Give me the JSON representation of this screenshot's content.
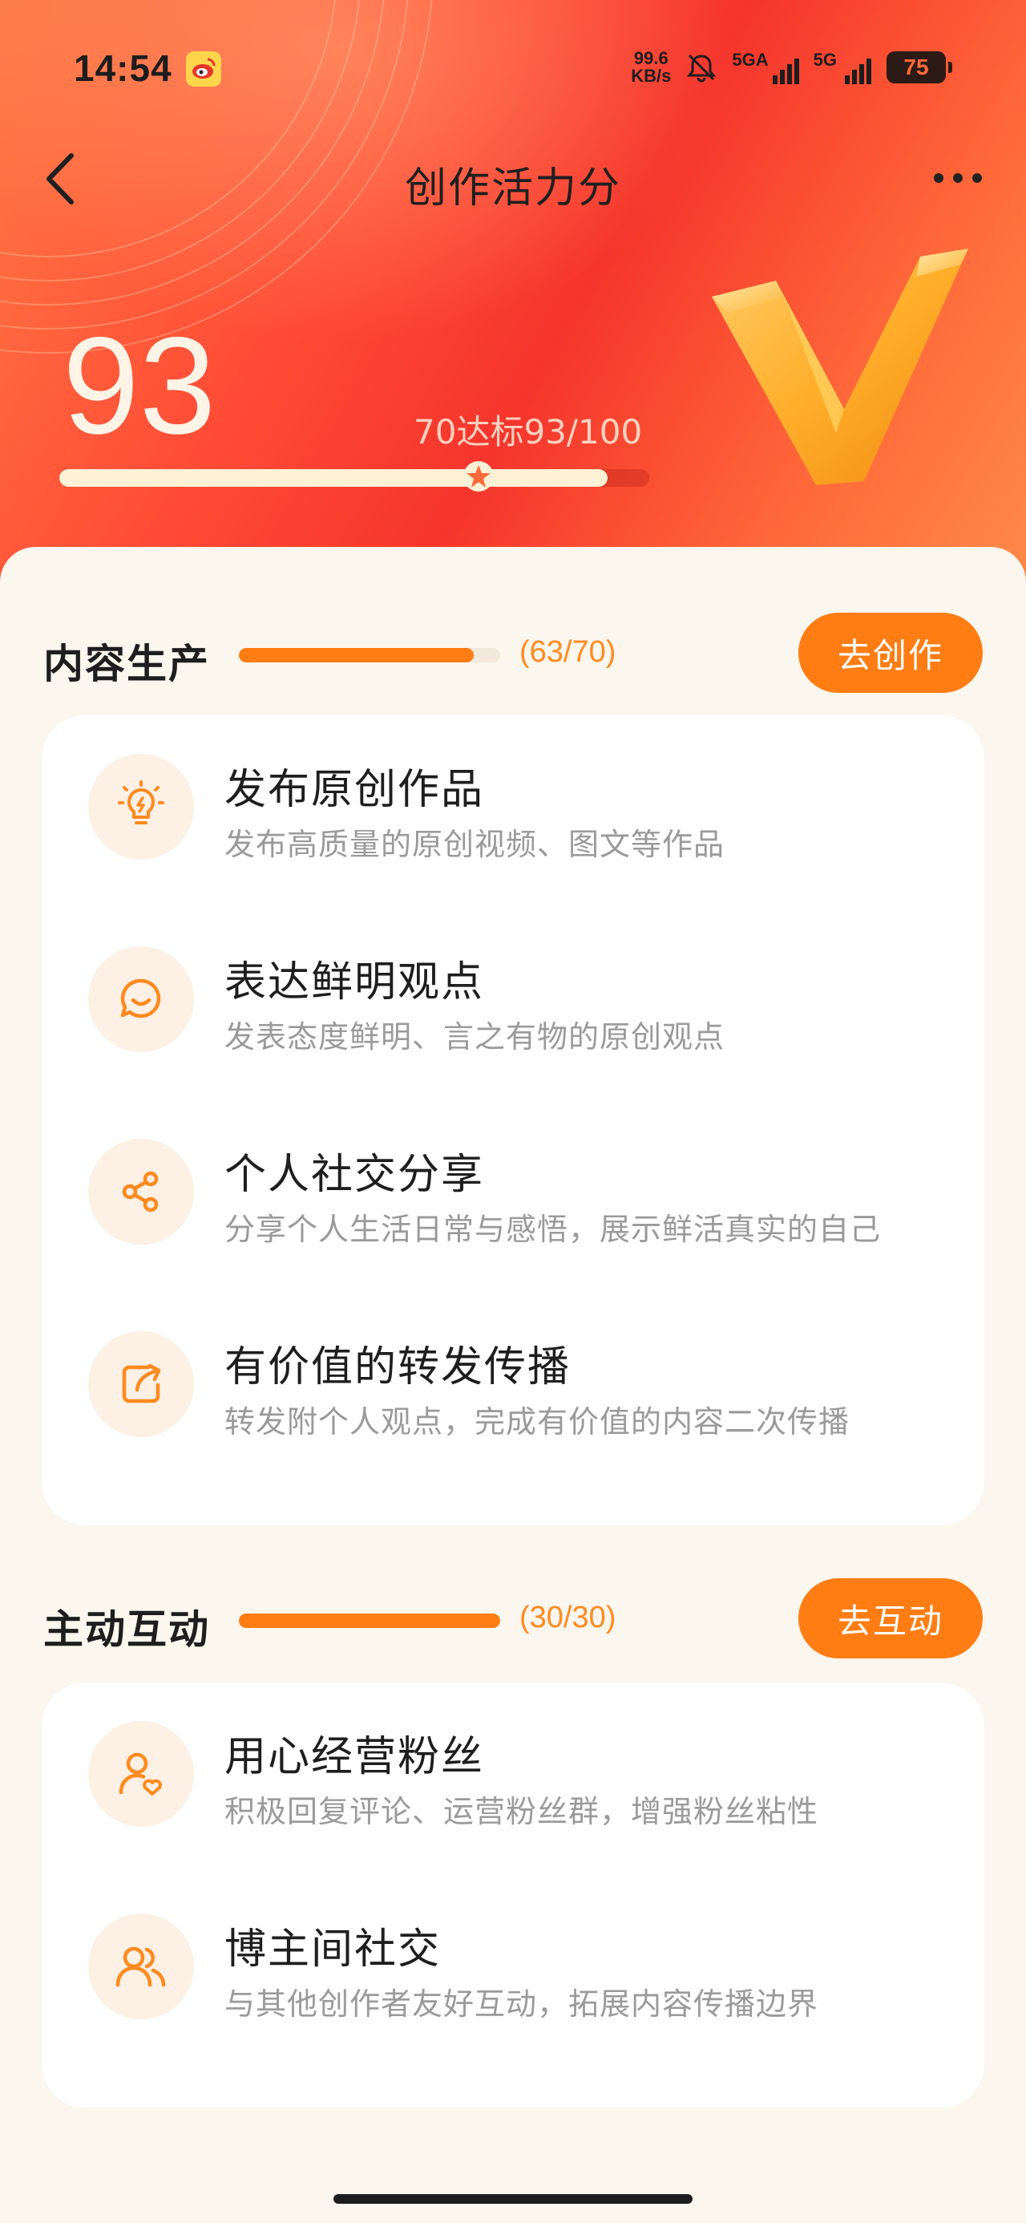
{
  "status_bar": {
    "time": "14:54",
    "net_speed_value": "99.6",
    "net_speed_unit": "KB/s",
    "signal1_label": "5GA",
    "signal2_label": "5G",
    "battery": "75"
  },
  "nav": {
    "title": "创作活力分"
  },
  "score": {
    "value": "93",
    "hint": "70达标93/100",
    "progress_fraction": 0.93,
    "target_fraction": 0.7
  },
  "sections": [
    {
      "title": "内容生产",
      "count": "(63/70)",
      "progress_fraction": 0.9,
      "button": "去创作",
      "items": [
        {
          "icon": "lightbulb-icon",
          "title": "发布原创作品",
          "desc": "发布高质量的原创视频、图文等作品"
        },
        {
          "icon": "chat-smile-icon",
          "title": "表达鲜明观点",
          "desc": "发表态度鲜明、言之有物的原创观点"
        },
        {
          "icon": "share-icon",
          "title": "个人社交分享",
          "desc": "分享个人生活日常与感悟，展示鲜活真实的自己"
        },
        {
          "icon": "repost-icon",
          "title": "有价值的转发传播",
          "desc": "转发附个人观点，完成有价值的内容二次传播"
        }
      ]
    },
    {
      "title": "主动互动",
      "count": "(30/30)",
      "progress_fraction": 1.0,
      "button": "去互动",
      "items": [
        {
          "icon": "user-heart-icon",
          "title": "用心经营粉丝",
          "desc": "积极回复评论、运营粉丝群，增强粉丝粘性"
        },
        {
          "icon": "users-icon",
          "title": "博主间社交",
          "desc": "与其他创作者友好互动，拓展内容传播边界"
        }
      ]
    }
  ],
  "colors": {
    "accent": "#ff7d12",
    "icon_bg": "#fdf0e4",
    "page_bg": "#fbf6ee"
  }
}
